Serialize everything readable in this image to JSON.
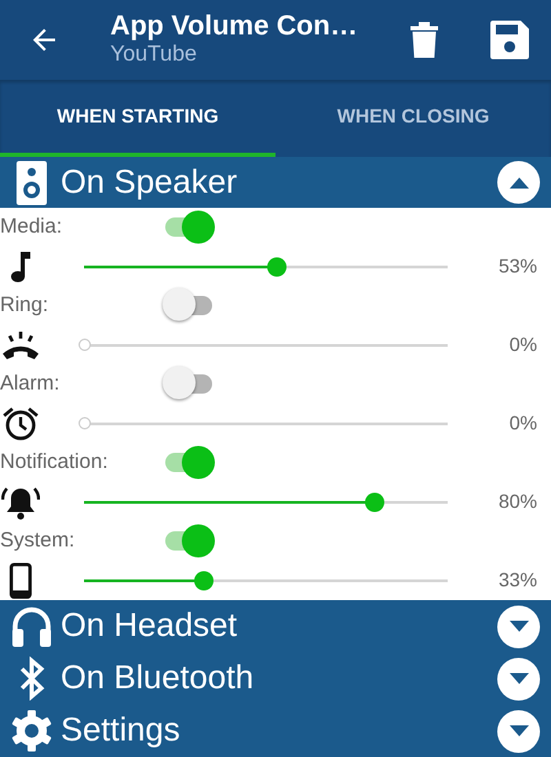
{
  "toolbar": {
    "title": "App Volume Con…",
    "subtitle": "YouTube"
  },
  "tabs": [
    {
      "label": "WHEN STARTING",
      "selected": true
    },
    {
      "label": "WHEN CLOSING",
      "selected": false
    }
  ],
  "sections": [
    {
      "title": "On Speaker",
      "expanded": true,
      "channels": [
        {
          "label": "Media:",
          "on": true,
          "level": 0.53,
          "reading": "53%"
        },
        {
          "label": "Ring:",
          "on": false,
          "level": 0,
          "reading": "0%"
        },
        {
          "label": "Alarm:",
          "on": false,
          "level": 0,
          "reading": "0%"
        },
        {
          "label": "Notification:",
          "on": true,
          "level": 0.8,
          "reading": "80%"
        },
        {
          "label": "System:",
          "on": true,
          "level": 0.33,
          "reading": "33%"
        }
      ]
    },
    {
      "title": "On Headset",
      "expanded": false
    },
    {
      "title": "On Bluetooth",
      "expanded": false
    },
    {
      "title": "Settings",
      "expanded": false
    }
  ]
}
